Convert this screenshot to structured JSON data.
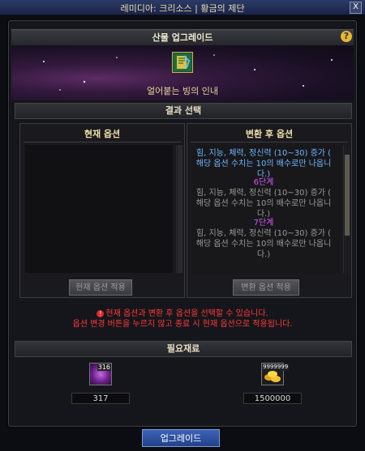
{
  "window": {
    "title": "레미디아: 크리소스 | 황금의 제단",
    "close_label": "X"
  },
  "header": {
    "title": "산물 업그레이드",
    "help_label": "?"
  },
  "item": {
    "name": "얼어붙는 빙의 인내",
    "icon": "item-icon"
  },
  "result_section": {
    "title": "결과 선택"
  },
  "current_panel": {
    "title": "현재 옵션",
    "apply_button": "현재 옵션 적용"
  },
  "changed_panel": {
    "title": "변환 후 옵션",
    "options": [
      {
        "stage": "",
        "text1": "힘, 지능, 체력, 정신력 (10~30) 증가 (",
        "text2": "해당 옵션 수치는 10의 배수로만 나옵니다.)",
        "color": "#6fb6ff"
      },
      {
        "stage": "6단계",
        "text1": "힘, 지능, 체력, 정신력 (10~30) 증가 (",
        "text2": "해당 옵션 수치는 10의 배수로만 나옵니다.)",
        "color": "#9a9a9a"
      },
      {
        "stage": "7단계",
        "text1": "힘, 지능, 체력, 정신력 (10~30) 증가 (",
        "text2": "해당 옵션 수치는 10의 배수로만 나옵니다.)",
        "color": "#9a9a9a"
      }
    ],
    "apply_button": "변환 옵션 적용"
  },
  "warning": {
    "line1": "현재 옵션과 변환 후 옵션을 선택할 수 있습니다.",
    "line2": "옵션 변경 버튼을 누르지 않고 종료 시 현재 옵션으로 적용됩니다."
  },
  "materials": {
    "title": "필요재료",
    "items": [
      {
        "badge": "316",
        "qty": "317",
        "icon": "purple-orb-icon"
      },
      {
        "badge": "9999999",
        "qty": "1500000",
        "icon": "gold-coins-icon"
      }
    ]
  },
  "footer": {
    "upgrade_button": "업그레이드"
  },
  "colors": {
    "stage": "#d957ff",
    "warning": "#ff3a3a",
    "accent": "#3c63b8"
  }
}
